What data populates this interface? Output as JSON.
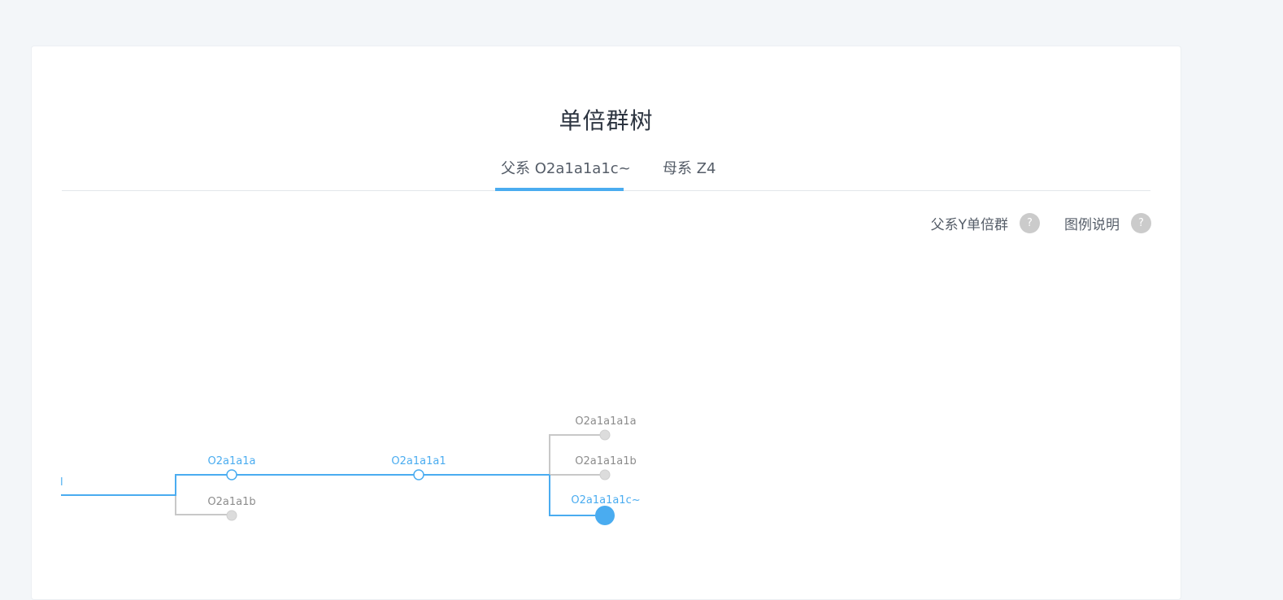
{
  "page": {
    "title": "单倍群树",
    "tabs": [
      {
        "label": "父系 O2a1a1a1c~",
        "active": true
      },
      {
        "label": "母系 Z4",
        "active": false
      }
    ],
    "tools": [
      {
        "label": "父系Y单倍群",
        "help_glyph": "?"
      },
      {
        "label": "图例说明",
        "help_glyph": "?"
      }
    ]
  },
  "tree": {
    "edge_label": "l",
    "nodes": [
      {
        "label": "O2a1a1a",
        "state": "on-path"
      },
      {
        "label": "O2a1a1b",
        "state": "off-path"
      },
      {
        "label": "O2a1a1a1",
        "state": "on-path"
      },
      {
        "label": "O2a1a1a1a",
        "state": "off-path"
      },
      {
        "label": "O2a1a1a1b",
        "state": "off-path"
      },
      {
        "label": "O2a1a1a1c~",
        "state": "current"
      }
    ]
  },
  "colors": {
    "accent": "#4aacf0",
    "inactive_line": "#c8c8c8",
    "inactive_node": "#dcdcdc",
    "inactive_label": "#8c8c8c",
    "title_text": "#2c3440",
    "background": "#f3f6f9"
  }
}
